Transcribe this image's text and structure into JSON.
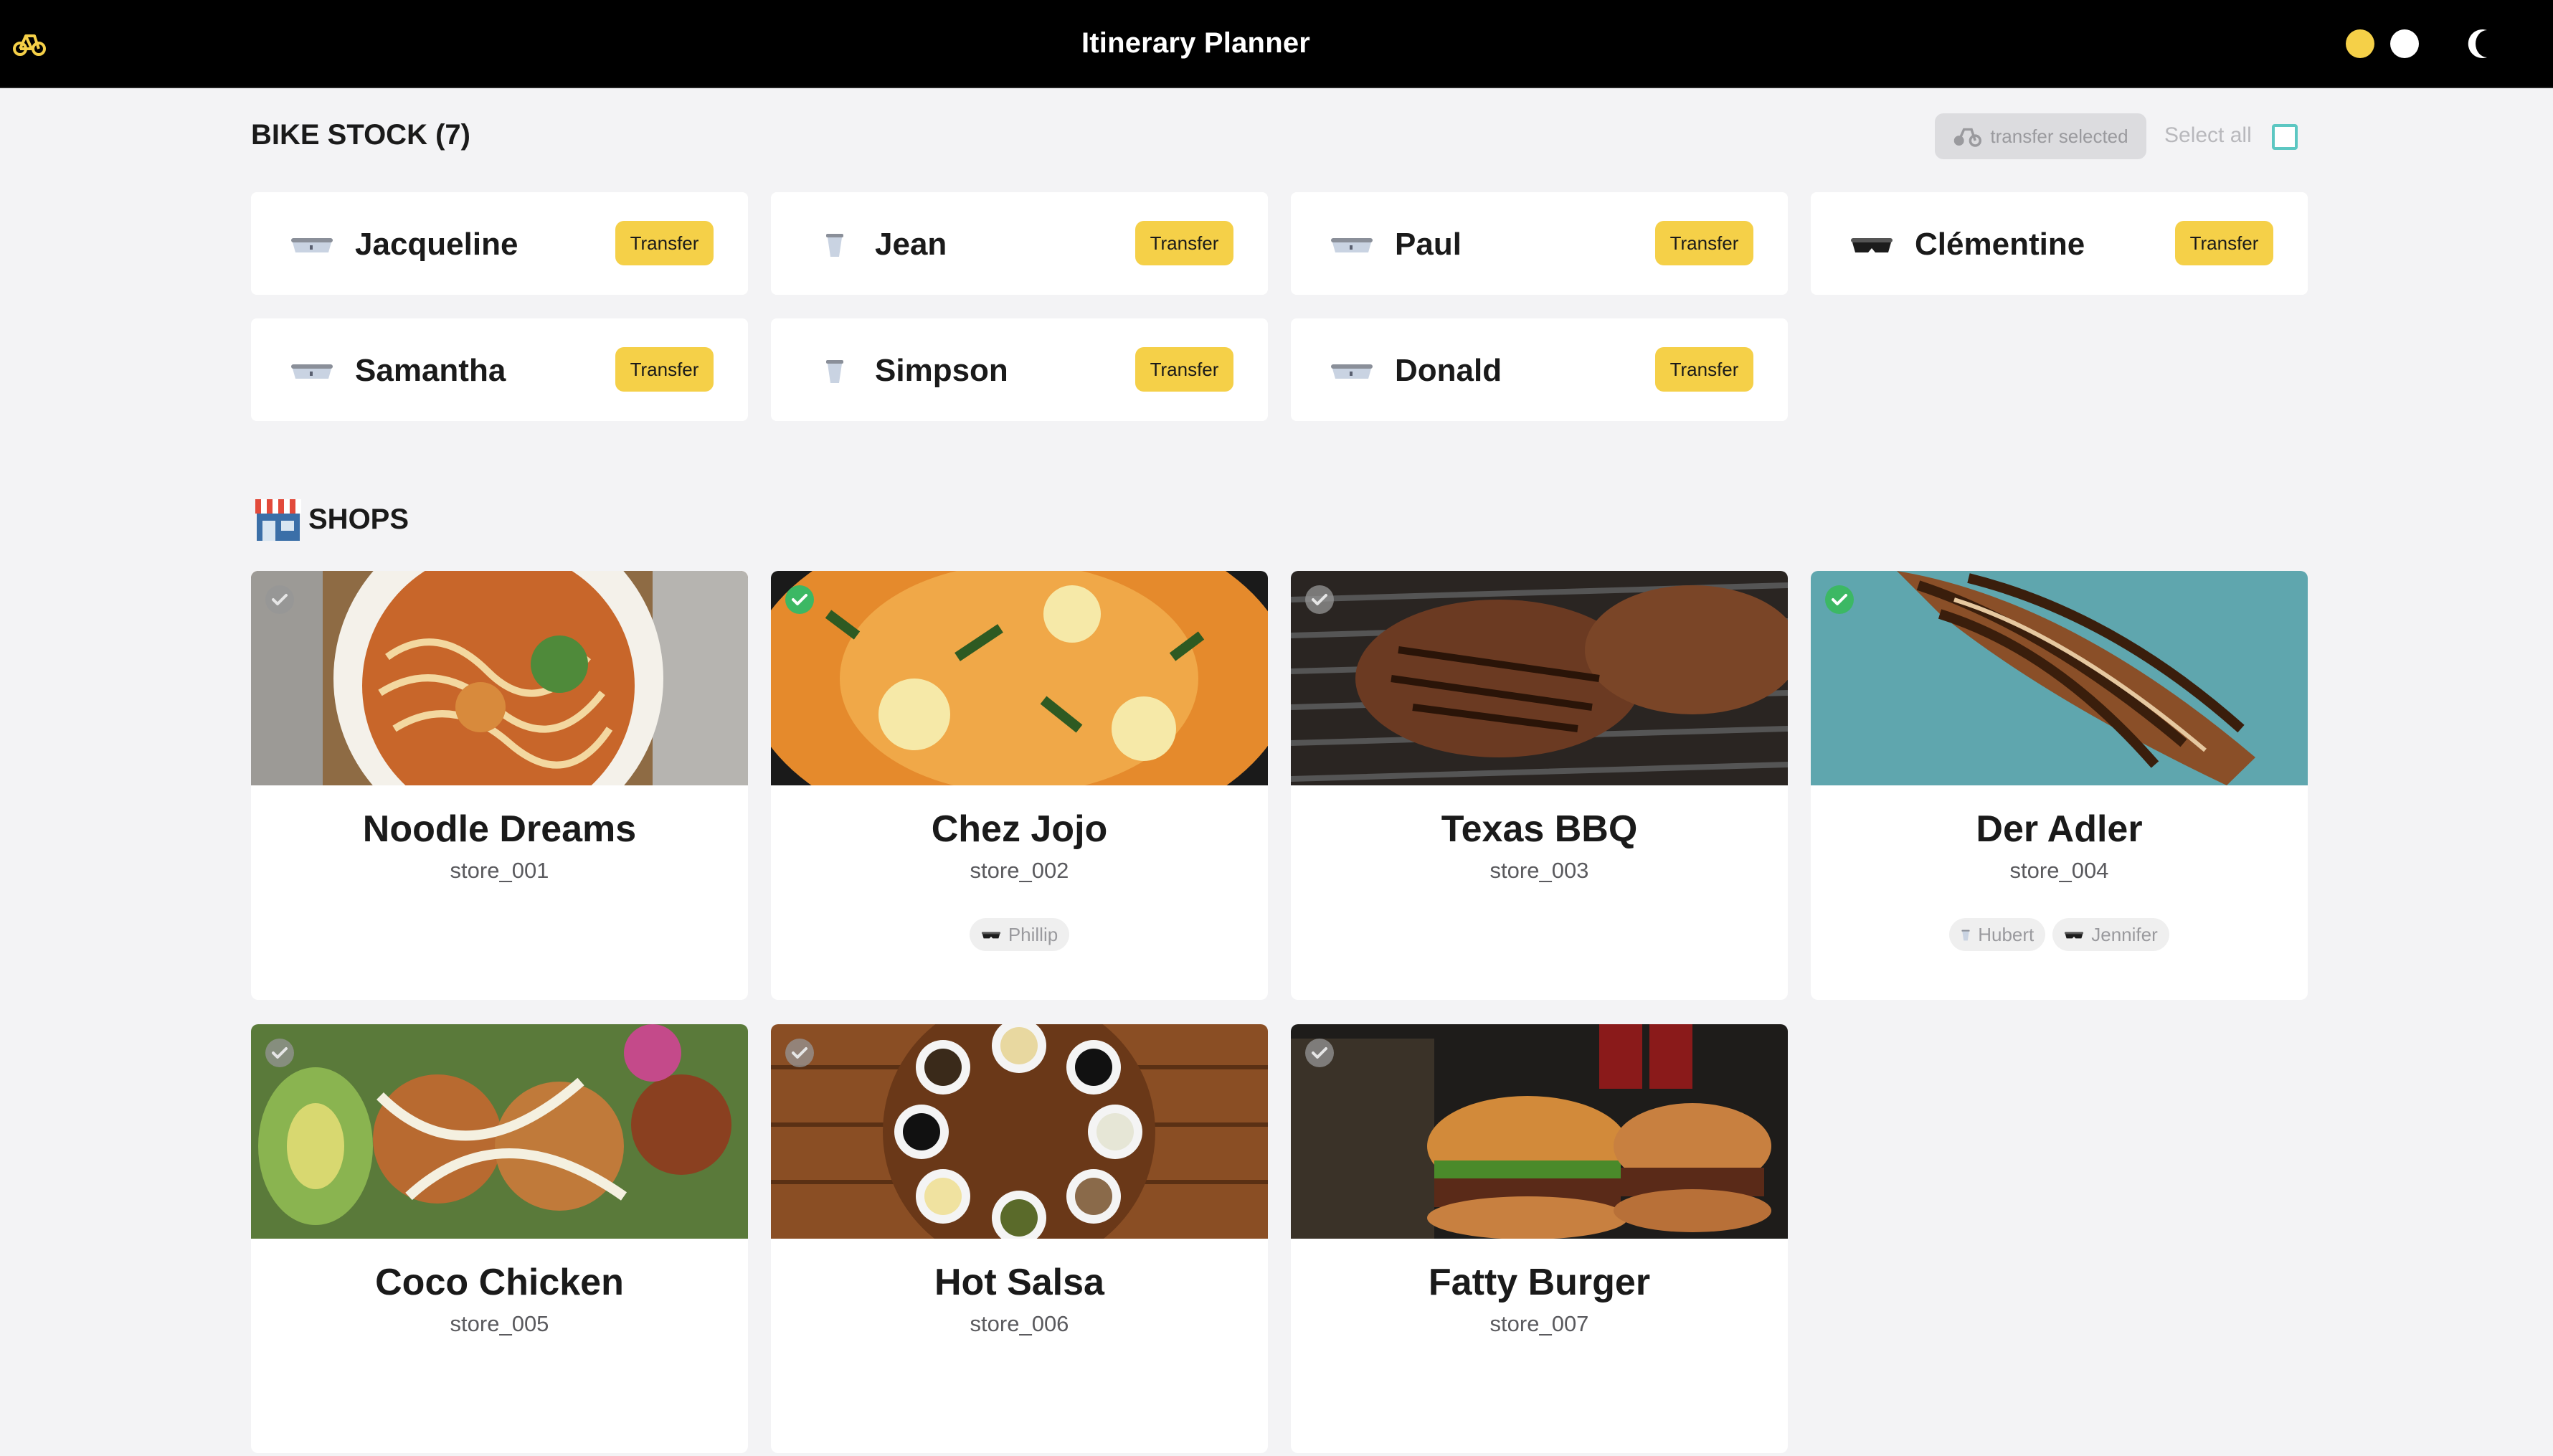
{
  "app": {
    "title": "Itinerary Planner",
    "logo_icon": "bike-logo-icon"
  },
  "theme": {
    "accent": "#f5d048",
    "success": "#3cb864",
    "teal": "#5cc7c2",
    "header_bg": "#000000"
  },
  "bike_stock": {
    "title": "BIKE STOCK (7)",
    "transfer_selected_label": "transfer selected",
    "select_all_label": "Select all",
    "transfer_label": "Transfer",
    "bikes": [
      {
        "name": "Jacqueline",
        "icon": "tray-icon"
      },
      {
        "name": "Jean",
        "icon": "cup-icon"
      },
      {
        "name": "Paul",
        "icon": "tray-icon"
      },
      {
        "name": "Clémentine",
        "icon": "mask-icon"
      },
      {
        "name": "Samantha",
        "icon": "tray-icon"
      },
      {
        "name": "Simpson",
        "icon": "cup-icon"
      },
      {
        "name": "Donald",
        "icon": "tray-icon"
      }
    ]
  },
  "shops": {
    "title": "SHOPS",
    "items": [
      {
        "name": "Noodle Dreams",
        "id": "store_001",
        "selected": false,
        "image": "noodle-soup-photo",
        "bikes": []
      },
      {
        "name": "Chez Jojo",
        "id": "store_002",
        "selected": true,
        "image": "salmon-dish-photo",
        "bikes": [
          {
            "name": "Phillip",
            "icon": "mask-icon"
          }
        ]
      },
      {
        "name": "Texas BBQ",
        "id": "store_003",
        "selected": false,
        "image": "grilled-steak-photo",
        "bikes": []
      },
      {
        "name": "Der Adler",
        "id": "store_004",
        "selected": true,
        "image": "eagle-wing-photo",
        "bikes": [
          {
            "name": "Hubert",
            "icon": "cup-icon"
          },
          {
            "name": "Jennifer",
            "icon": "mask-icon"
          }
        ]
      },
      {
        "name": "Coco Chicken",
        "id": "store_005",
        "selected": false,
        "image": "chickpea-salad-photo",
        "bikes": []
      },
      {
        "name": "Hot Salsa",
        "id": "store_006",
        "selected": false,
        "image": "sauce-bowls-photo",
        "bikes": []
      },
      {
        "name": "Fatty Burger",
        "id": "store_007",
        "selected": false,
        "image": "burgers-photo",
        "bikes": []
      }
    ]
  }
}
